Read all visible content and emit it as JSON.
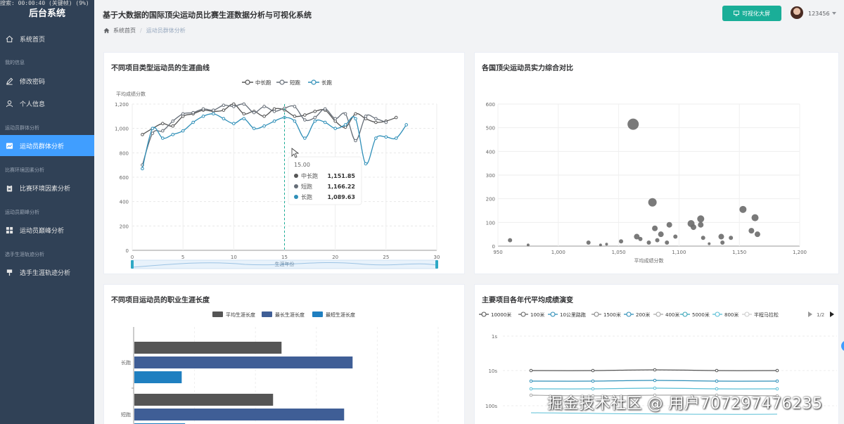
{
  "rec_bar": "搜索: 00:00:40 (关键帧) (9%)",
  "sidebar": {
    "logo": "后台系统",
    "items": [
      {
        "label": "系统首页",
        "group": ""
      },
      {
        "label": "修改密码",
        "group": "我的信息"
      },
      {
        "label": "个人信息",
        "group": ""
      },
      {
        "label": "运动员群体分析",
        "group": "运动员群体分析"
      },
      {
        "label": "比赛环境因素分析",
        "group": "比赛环境因素分析"
      },
      {
        "label": "运动员巅峰分析",
        "group": "运动员巅峰分析"
      },
      {
        "label": "选手生涯轨迹分析",
        "group": "选手生涯轨迹分析"
      }
    ],
    "active_index": 3
  },
  "header": {
    "title": "基于大数据的国际顶尖运动员比赛生涯数据分析与可视化系统",
    "breadcrumb_home": "系统首页",
    "breadcrumb_sep": "/",
    "breadcrumb_current": "运动员群体分析",
    "big_screen_button": "可视化大屏",
    "username": "123456"
  },
  "colors": {
    "sidebar_bg": "#304156",
    "active": "#409eff",
    "button": "#1aae98",
    "s_mid": "#555555",
    "s_short": "#666e78",
    "s_long": "#2f8fb8",
    "bar_avg": "#555555",
    "bar_max": "#3f5e96",
    "bar_min": "#1f7fc0"
  },
  "panels": {
    "career_curve": "不同项目类型运动员的生涯曲线",
    "country_compare": "各国顶尖运动员实力综合对比",
    "career_length": "不同项目运动员的职业生涯长度",
    "era_evolution": "主要项目各年代平均成绩演变"
  },
  "chart_data": [
    {
      "type": "line",
      "title": "不同项目类型运动员的生涯曲线",
      "ylabel": "平均成绩分数",
      "xlabel": "",
      "xlim": [
        0,
        30
      ],
      "ylim": [
        0,
        1200
      ],
      "x_ticks": [
        0,
        5,
        10,
        15,
        20,
        25,
        30
      ],
      "y_ticks": [
        0,
        200,
        400,
        600,
        800,
        "1,000",
        "1,200"
      ],
      "legend": "top-center",
      "zoom_slider_label": "生涯年份",
      "series": [
        {
          "name": "中长跑",
          "x": [
            1,
            2,
            3,
            4,
            5,
            6,
            7,
            8,
            9,
            10,
            11,
            12,
            13,
            14,
            15,
            16,
            17,
            18,
            19,
            20,
            21,
            22,
            23,
            24,
            25,
            26,
            27
          ],
          "values": [
            950,
            1000,
            1040,
            1020,
            1100,
            1120,
            1150,
            1140,
            1150,
            1200,
            1120,
            1140,
            1100,
            1160,
            1152,
            1100,
            1110,
            1140,
            1150,
            1060,
            1010,
            1120,
            1080,
            1050,
            1060,
            1090,
            null
          ]
        },
        {
          "name": "短跑",
          "x": [
            1,
            2,
            3,
            4,
            5,
            6,
            7,
            8,
            9,
            10,
            11,
            12,
            13,
            14,
            15,
            16,
            17,
            18,
            19,
            20,
            21,
            22,
            23,
            24,
            25,
            26,
            27
          ],
          "values": [
            700,
            960,
            980,
            1060,
            1120,
            1130,
            1160,
            1150,
            1190,
            1180,
            1200,
            1130,
            1180,
            1140,
            1166,
            1180,
            1070,
            1090,
            1160,
            1080,
            1120,
            900,
            1100,
            1080,
            1050,
            null,
            null
          ]
        },
        {
          "name": "长跑",
          "x": [
            1,
            2,
            3,
            4,
            5,
            6,
            7,
            8,
            9,
            10,
            11,
            12,
            13,
            14,
            15,
            16,
            17,
            18,
            19,
            20,
            21,
            22,
            23,
            24,
            25,
            26,
            27
          ],
          "values": [
            670,
            1000,
            920,
            950,
            980,
            1050,
            1100,
            1120,
            1080,
            1040,
            1080,
            1000,
            1020,
            1060,
            1090,
            1060,
            920,
            1060,
            1050,
            1000,
            1030,
            1080,
            710,
            920,
            930,
            920,
            1030
          ]
        }
      ],
      "tooltip": {
        "x": "15.00",
        "rows": [
          {
            "name": "中长跑",
            "value": "1,151.85"
          },
          {
            "name": "短跑",
            "value": "1,166.22"
          },
          {
            "name": "长跑",
            "value": "1,089.63"
          }
        ]
      }
    },
    {
      "type": "scatter",
      "title": "各国顶尖运动员实力综合对比",
      "xlabel": "平均成绩分数",
      "ylabel": "",
      "xlim": [
        950,
        1200
      ],
      "ylim": [
        0,
        600
      ],
      "x_ticks": [
        950,
        "1,000",
        "1,050",
        "1,100",
        "1,150",
        "1,200"
      ],
      "y_ticks": [
        0,
        100,
        200,
        300,
        400,
        500,
        600
      ],
      "points": [
        {
          "x": 960,
          "y": 25,
          "r": 3
        },
        {
          "x": 975,
          "y": 5,
          "r": 2
        },
        {
          "x": 1025,
          "y": 15,
          "r": 3
        },
        {
          "x": 1035,
          "y": 5,
          "r": 2
        },
        {
          "x": 1040,
          "y": 8,
          "r": 2
        },
        {
          "x": 1052,
          "y": 20,
          "r": 3
        },
        {
          "x": 1062,
          "y": 515,
          "r": 8
        },
        {
          "x": 1065,
          "y": 40,
          "r": 4
        },
        {
          "x": 1068,
          "y": 30,
          "r": 3
        },
        {
          "x": 1075,
          "y": 15,
          "r": 3
        },
        {
          "x": 1078,
          "y": 185,
          "r": 6
        },
        {
          "x": 1080,
          "y": 75,
          "r": 4
        },
        {
          "x": 1082,
          "y": 25,
          "r": 3
        },
        {
          "x": 1085,
          "y": 50,
          "r": 4
        },
        {
          "x": 1090,
          "y": 15,
          "r": 3
        },
        {
          "x": 1092,
          "y": 90,
          "r": 4
        },
        {
          "x": 1097,
          "y": 40,
          "r": 3
        },
        {
          "x": 1110,
          "y": 95,
          "r": 5
        },
        {
          "x": 1112,
          "y": 80,
          "r": 4
        },
        {
          "x": 1118,
          "y": 115,
          "r": 5
        },
        {
          "x": 1118,
          "y": 90,
          "r": 4
        },
        {
          "x": 1120,
          "y": 35,
          "r": 3
        },
        {
          "x": 1125,
          "y": 10,
          "r": 2
        },
        {
          "x": 1135,
          "y": 40,
          "r": 4
        },
        {
          "x": 1136,
          "y": 15,
          "r": 3
        },
        {
          "x": 1143,
          "y": 35,
          "r": 3
        },
        {
          "x": 1153,
          "y": 155,
          "r": 5
        },
        {
          "x": 1160,
          "y": 65,
          "r": 4
        },
        {
          "x": 1163,
          "y": 120,
          "r": 5
        },
        {
          "x": 1165,
          "y": 50,
          "r": 4
        }
      ]
    },
    {
      "type": "bar",
      "title": "不同项目运动员的职业生涯长度",
      "orientation": "horizontal",
      "legend": "top-center",
      "categories": [
        "长跑",
        "短跑"
      ],
      "series": [
        {
          "name": "平均生涯长度",
          "values": [
            8.7,
            8.2
          ]
        },
        {
          "name": "最长生涯长度",
          "values": [
            12.9,
            12.4
          ]
        },
        {
          "name": "最短生涯长度",
          "values": [
            2.8,
            3.0
          ]
        }
      ]
    },
    {
      "type": "line",
      "title": "主要项目各年代平均成绩演变",
      "legend": "top",
      "legend_page": "1/2",
      "series_names": [
        "10000米",
        "100米",
        "10公里路跑",
        "1500米",
        "200米",
        "400米",
        "5000米",
        "800米",
        "半程马拉松"
      ],
      "y_scale": "log",
      "y_tick_labels": [
        "1s",
        "10s",
        "100s"
      ]
    }
  ],
  "watermark": "掘金技术社区 @ 用户707297476235"
}
